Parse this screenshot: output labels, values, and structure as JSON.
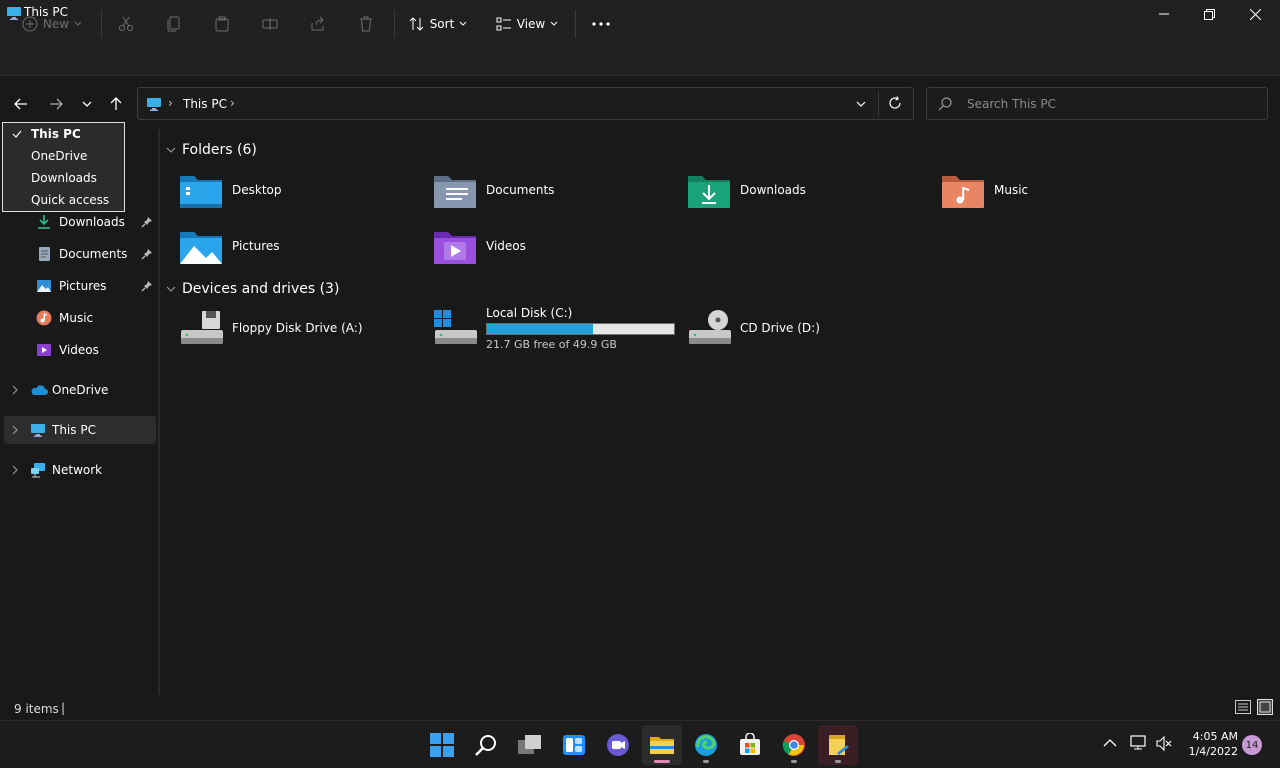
{
  "window": {
    "title": "This PC"
  },
  "toolbar": {
    "new_label": "New",
    "sort_label": "Sort",
    "view_label": "View"
  },
  "address": {
    "breadcrumb": "This PC",
    "separator": "›"
  },
  "search": {
    "placeholder": "Search This PC"
  },
  "history_dropdown": {
    "items": [
      {
        "label": "This PC",
        "checked": true
      },
      {
        "label": "OneDrive",
        "checked": false
      },
      {
        "label": "Downloads",
        "checked": false
      },
      {
        "label": "Quick access",
        "checked": false
      }
    ]
  },
  "sidebar": {
    "quick_items": [
      {
        "label": "Downloads",
        "icon": "download-icon",
        "pinned": true
      },
      {
        "label": "Documents",
        "icon": "documents-icon",
        "pinned": true
      },
      {
        "label": "Pictures",
        "icon": "pictures-icon",
        "pinned": true
      },
      {
        "label": "Music",
        "icon": "music-icon",
        "pinned": false
      },
      {
        "label": "Videos",
        "icon": "videos-icon",
        "pinned": false
      }
    ],
    "roots": [
      {
        "label": "OneDrive",
        "icon": "cloud-icon"
      },
      {
        "label": "This PC",
        "icon": "monitor-icon",
        "selected": true
      },
      {
        "label": "Network",
        "icon": "network-icon"
      }
    ]
  },
  "main": {
    "folders_header": "Folders (6)",
    "folders": [
      {
        "label": "Desktop",
        "icon": "desktop-folder-icon",
        "color": "#1e90d6"
      },
      {
        "label": "Documents",
        "icon": "documents-folder-icon",
        "color": "#7a8ca8"
      },
      {
        "label": "Downloads",
        "icon": "downloads-folder-icon",
        "color": "#1aa37a"
      },
      {
        "label": "Music",
        "icon": "music-folder-icon",
        "color": "#e07a4f"
      },
      {
        "label": "Pictures",
        "icon": "pictures-folder-icon",
        "color": "#1e90d6"
      },
      {
        "label": "Videos",
        "icon": "videos-folder-icon",
        "color": "#8a3fd1"
      }
    ],
    "drives_header": "Devices and drives (3)",
    "drives": [
      {
        "label": "Floppy Disk Drive (A:)",
        "icon": "floppy-drive-icon"
      },
      {
        "label": "Local Disk (C:)",
        "icon": "local-disk-icon",
        "free_text": "21.7 GB free of 49.9 GB",
        "used_fraction": 0.565
      },
      {
        "label": "CD Drive (D:)",
        "icon": "cd-drive-icon"
      }
    ]
  },
  "status": {
    "items_text": "9 items",
    "cursor": "|"
  },
  "taskbar": {
    "time": "4:05 AM",
    "date": "1/4/2022",
    "notification_count": "14",
    "apps": [
      {
        "name": "start-button"
      },
      {
        "name": "search-button"
      },
      {
        "name": "task-view-button"
      },
      {
        "name": "widgets-button"
      },
      {
        "name": "teams-chat-button"
      },
      {
        "name": "file-explorer-button",
        "active": true
      },
      {
        "name": "edge-button"
      },
      {
        "name": "store-button"
      },
      {
        "name": "chrome-button"
      },
      {
        "name": "sticky-app-button"
      }
    ]
  },
  "colors": {
    "accent": "#4cc2ff",
    "selection": "#2d2d2d",
    "progress": "#26a0da",
    "badge": "#c79ad6"
  }
}
